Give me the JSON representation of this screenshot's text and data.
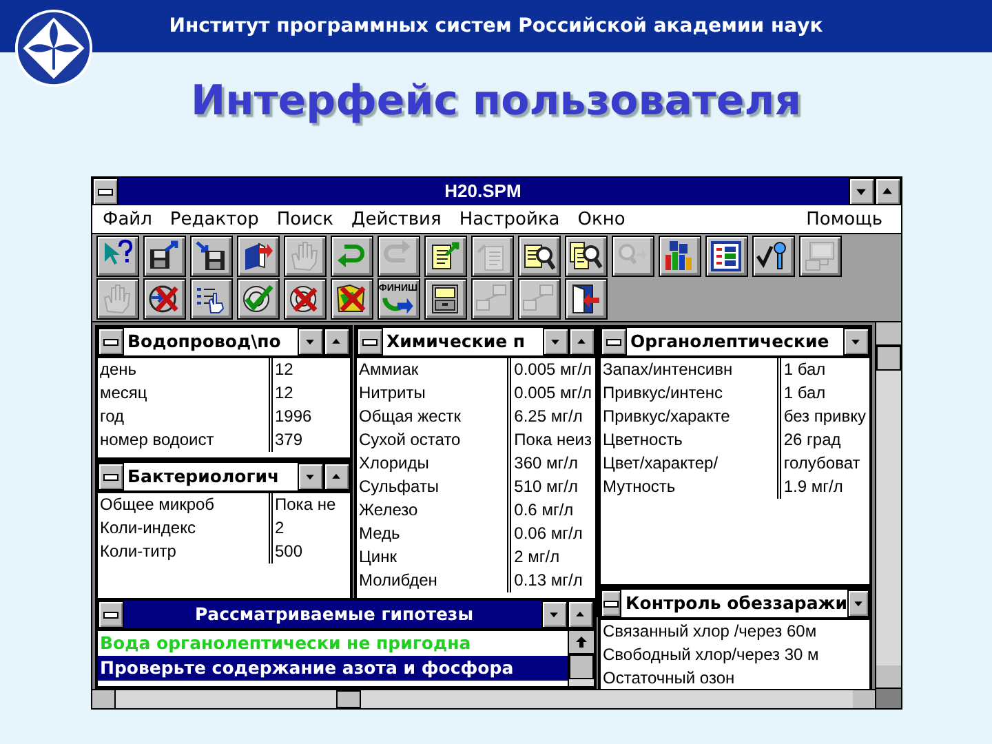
{
  "header": {
    "organization": "Институт программных систем Российской академии наук",
    "title": "Интерфейс пользователя"
  },
  "app": {
    "title": "H20.SPM",
    "menu": [
      {
        "label": "Файл"
      },
      {
        "label": "Редактор"
      },
      {
        "label": "Поиск"
      },
      {
        "label": "Действия"
      },
      {
        "label": "Настройка"
      },
      {
        "label": "Окно"
      },
      {
        "label": "Помощь"
      }
    ],
    "toolbar_rows": [
      [
        {
          "kind": "help",
          "disabled": false
        },
        {
          "kind": "save-out",
          "disabled": false
        },
        {
          "kind": "save-in",
          "disabled": false
        },
        {
          "kind": "book",
          "disabled": false
        },
        {
          "kind": "hand",
          "disabled": true
        },
        {
          "kind": "undo",
          "disabled": false
        },
        {
          "kind": "redo",
          "disabled": true
        },
        {
          "kind": "doc-out",
          "disabled": false
        },
        {
          "kind": "doc",
          "disabled": true
        },
        {
          "kind": "doc-search",
          "disabled": false
        },
        {
          "kind": "docs-search",
          "disabled": false
        },
        {
          "kind": "search-next",
          "disabled": true
        },
        {
          "kind": "alphabet",
          "disabled": false
        },
        {
          "kind": "form",
          "disabled": false
        },
        {
          "kind": "check",
          "disabled": false
        },
        {
          "kind": "monitor",
          "disabled": true
        }
      ],
      [
        {
          "kind": "hand",
          "disabled": true
        },
        {
          "kind": "cancel",
          "disabled": false
        },
        {
          "kind": "list",
          "disabled": false
        },
        {
          "kind": "target-check",
          "disabled": false
        },
        {
          "kind": "target-cancel",
          "disabled": false
        },
        {
          "kind": "map-cancel",
          "disabled": false
        },
        {
          "kind": "finish",
          "label": "ФИНИШ",
          "disabled": false
        },
        {
          "kind": "cabinet",
          "disabled": false
        },
        {
          "kind": "network",
          "disabled": true
        },
        {
          "kind": "network",
          "disabled": true
        },
        {
          "kind": "door",
          "disabled": false
        }
      ]
    ],
    "windows": [
      {
        "title": "Водопровод\\по",
        "active": false,
        "rows": [
          [
            "день",
            "12"
          ],
          [
            "месяц",
            "12"
          ],
          [
            "год",
            "1996"
          ],
          [
            "номер водоист",
            "379"
          ]
        ]
      },
      {
        "title": "Бактериологич",
        "active": false,
        "rows": [
          [
            "Общее микроб",
            "Пока не"
          ],
          [
            "Коли-индекс",
            "2"
          ],
          [
            "Коли-титр",
            "500"
          ]
        ]
      },
      {
        "title": "Химические п",
        "active": false,
        "rows": [
          [
            "Аммиак",
            "0.005 мг/л"
          ],
          [
            "Нитриты",
            "0.005 мг/л"
          ],
          [
            "Общая жестк",
            "6.25 мг/л"
          ],
          [
            "Сухой остато",
            "Пока неиз"
          ],
          [
            "Хлориды",
            "360 мг/л"
          ],
          [
            "Сульфаты",
            "510 мг/л"
          ],
          [
            "Железо",
            "0.6 мг/л"
          ],
          [
            "Медь",
            "0.06 мг/л"
          ],
          [
            "Цинк",
            "2 мг/л"
          ],
          [
            "Молибден",
            "0.13 мг/л"
          ]
        ]
      },
      {
        "title": "Органолептические",
        "active": false,
        "rows": [
          [
            "Запах/интенсивн",
            "1 бал"
          ],
          [
            "Привкус/интенс",
            "1 бал"
          ],
          [
            "Привкус/характе",
            "без привку"
          ],
          [
            "Цветность",
            "26 град"
          ],
          [
            "Цвет/характер/",
            "голубоват"
          ],
          [
            "Мутность",
            "1.9 мг/л"
          ]
        ]
      },
      {
        "title": "Контроль обеззаражи",
        "active": false,
        "rows": [
          [
            "Связанный хлор /через 60м"
          ],
          [
            "Свободный хлор/через 30 м"
          ],
          [
            "Остаточный озон"
          ]
        ]
      }
    ],
    "hypotheses": {
      "title": "Рассматриваемые гипотезы",
      "active": true,
      "items": [
        {
          "text": "Вода органолептически  не пригодна",
          "selected": false
        },
        {
          "text": "Проверьте содержание азота и фосфора",
          "selected": true
        }
      ]
    }
  }
}
